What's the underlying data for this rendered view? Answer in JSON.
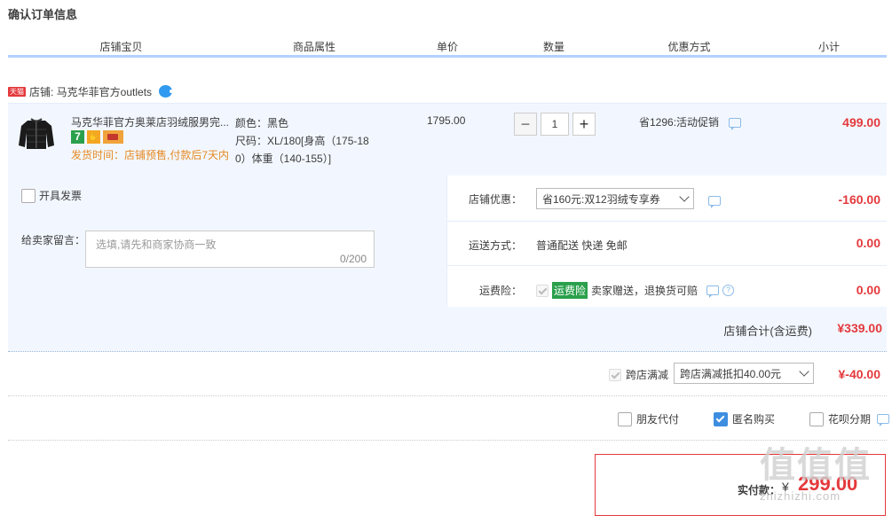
{
  "page_title": "确认订单信息",
  "columns": [
    "店铺宝贝",
    "商品属性",
    "单价",
    "数量",
    "优惠方式",
    "小计"
  ],
  "shop": {
    "badge": "天猫",
    "label": "店铺: 马克华菲官方outlets"
  },
  "item": {
    "title": "马克华菲官方奥莱店羽绒服男完...",
    "badge_7": "7",
    "ship_time": "发货时间：店铺预售,付款后7天内",
    "attr_color": "颜色：黑色",
    "attr_size_1": "尺码：XL/180[身高（175-18",
    "attr_size_2": "0）体重（140-155）]",
    "unit_price": "1795.00",
    "quantity": "1",
    "qty_minus": "−",
    "qty_plus": "+",
    "promo": "省1296:活动促销",
    "subtotal": "499.00"
  },
  "invoice_label": "开具发票",
  "memo": {
    "label": "给卖家留言：",
    "placeholder": "选填,请先和商家协商一致",
    "counter": "0/200"
  },
  "shop_discount": {
    "label": "店铺优惠：",
    "selected": "省160元:双12羽绒专享券",
    "value": "-160.00"
  },
  "shipping": {
    "label": "运送方式：",
    "text": "普通配送 快递 免邮",
    "value": "0.00"
  },
  "freight_ins": {
    "label": "运费险：",
    "tag": "运费险",
    "text": "卖家赠送，退换货可赔",
    "help": "?",
    "value": "0.00"
  },
  "shop_total": {
    "label": "店铺合计(含运费)",
    "value": "¥339.00"
  },
  "cross_store": {
    "label": "跨店满减",
    "selected": "跨店满减抵扣40.00元",
    "value": "¥-40.00"
  },
  "options": [
    {
      "label": "朋友代付",
      "checked": false
    },
    {
      "label": "匿名购买",
      "checked": true
    },
    {
      "label": "花呗分期",
      "checked": false
    }
  ],
  "final": {
    "label": "实付款：",
    "currency": "¥",
    "value": "299.00"
  },
  "watermark": {
    "main": "值值值",
    "sub": "zhizhizhi.com"
  },
  "colors": {
    "price_red": "#e4393c",
    "panel_blue": "#f2f7ff",
    "accent_blue": "#3d8ee0",
    "ship_orange": "#e68a22"
  }
}
